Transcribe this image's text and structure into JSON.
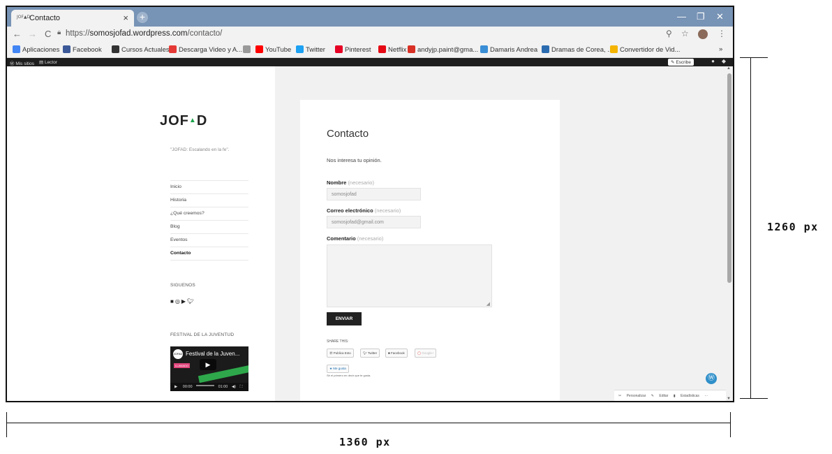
{
  "browser": {
    "tab": {
      "favicon": "JOF▲D",
      "title": "Contacto",
      "close": "×"
    },
    "new_tab": "+",
    "window_controls": {
      "minimize": "—",
      "restore": "❐",
      "close": "✕"
    },
    "nav": {
      "back": "←",
      "forward": "→",
      "reload": "C"
    },
    "url": {
      "prefix": "https://",
      "host": "somosjofad.wordpress.com",
      "path": "/contacto/"
    },
    "toolbar_icons": {
      "zoom": "⚲",
      "star": "☆",
      "menu": "⋮"
    },
    "bookmarks": [
      {
        "label": "Aplicaciones",
        "icon": "apps-icon",
        "color": "#4285f4"
      },
      {
        "label": "Facebook",
        "icon": "facebook-icon",
        "color": "#3b5998"
      },
      {
        "label": "Cursos Actuales",
        "icon": "cursos-icon",
        "color": "#333333"
      },
      {
        "label": "Descarga Video y A...",
        "icon": "download-icon",
        "color": "#e53935"
      },
      {
        "label": "",
        "icon": "page-icon",
        "color": "#999999"
      },
      {
        "label": "YouTube",
        "icon": "youtube-icon",
        "color": "#ff0000"
      },
      {
        "label": "Twitter",
        "icon": "twitter-icon",
        "color": "#1da1f2"
      },
      {
        "label": "Pinterest",
        "icon": "pinterest-icon",
        "color": "#e60023"
      },
      {
        "label": "Netflix",
        "icon": "netflix-icon",
        "color": "#e50914"
      },
      {
        "label": "andyjp.paint@gma...",
        "icon": "gmail-icon",
        "color": "#d93025"
      },
      {
        "label": "Damaris Andrea",
        "icon": "damaris-icon",
        "color": "#3a8ed6"
      },
      {
        "label": "Dramas de Corea, ...",
        "icon": "dramas-icon",
        "color": "#2b6cb0"
      },
      {
        "label": "Convertidor de Vid...",
        "icon": "convert-icon",
        "color": "#f4b400"
      }
    ],
    "bookmarks_more": "»"
  },
  "adminbar": {
    "my_sites": "Mis sitios",
    "reader": "Lector",
    "write": "Escribe"
  },
  "site": {
    "logo": "JOFAD",
    "tagline": "\"JOFAD: Escalando en la fe\".",
    "menu": [
      "Inicio",
      "Historia",
      "¿Qué creemos?",
      "Blog",
      "Eventos",
      "Contacto"
    ],
    "follow_title": "SIGUENOS",
    "social_icons": [
      "facebook-icon",
      "instagram-icon",
      "youtube-icon",
      "twitter-icon"
    ],
    "festival_title": "FESTIVAL DE LA JUVENTUD",
    "video": {
      "title": "Festival de la Juven...",
      "time_start": "00:00",
      "time_end": "01:00",
      "badge": "LLAMADO"
    }
  },
  "content": {
    "title": "Contacto",
    "intro": "Nos interesa tu opinión.",
    "name_label": "Nombre",
    "required": "(necesario)",
    "name_value": "somosjofad",
    "email_label": "Correo electrónico",
    "email_value": "somosjofad@gmail.com",
    "comment_label": "Comentario",
    "submit": "ENVIAR",
    "share_title": "SHARE THIS:",
    "share_buttons": [
      "Publica Esto",
      "Twitter",
      "Facebook",
      "Google+"
    ],
    "like": "Me gusta",
    "like_note": "Sé el primero en decir que te gusta."
  },
  "footerbar": {
    "customize": "Personalizar",
    "edit": "Editar",
    "stats": "Estadísticas",
    "more": "···"
  },
  "dimensions": {
    "height": "1260 px",
    "width": "1360 px"
  }
}
